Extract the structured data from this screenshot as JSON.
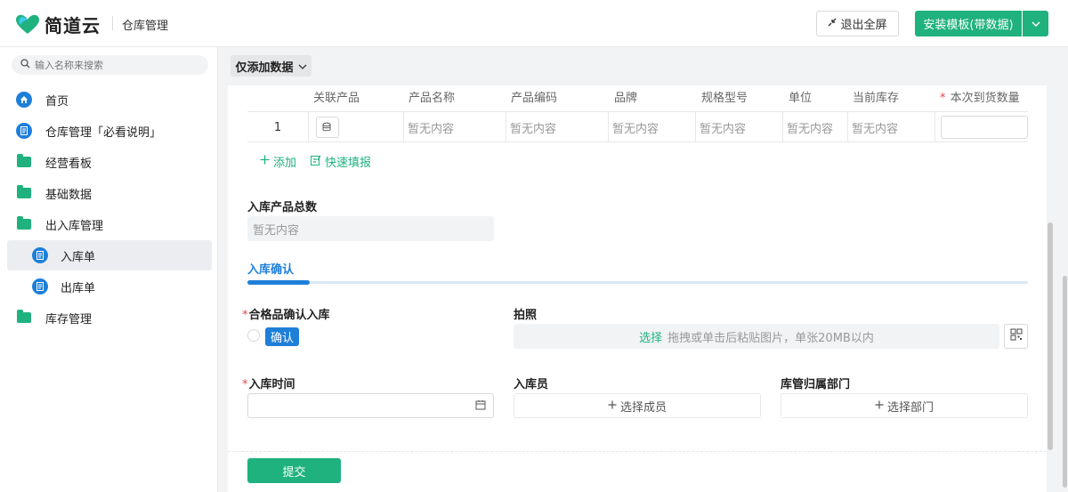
{
  "header": {
    "logo_text": "简道云",
    "app_title": "仓库管理",
    "exit_fullscreen": "退出全屏",
    "install_template": "安装模板(带数据)"
  },
  "sidebar": {
    "search_placeholder": "输入名称来搜索",
    "items": [
      {
        "label": "首页",
        "icon": "home-icon"
      },
      {
        "label": "仓库管理「必看说明」",
        "icon": "document-icon"
      },
      {
        "label": "经营看板",
        "icon": "folder-icon"
      },
      {
        "label": "基础数据",
        "icon": "folder-icon"
      },
      {
        "label": "出入库管理",
        "icon": "folder-open-icon"
      },
      {
        "label": "入库单",
        "icon": "form-icon",
        "active": true
      },
      {
        "label": "出库单",
        "icon": "form-icon"
      },
      {
        "label": "库存管理",
        "icon": "folder-icon"
      }
    ]
  },
  "toolbar": {
    "filter_label": "仅添加数据"
  },
  "table": {
    "headers": [
      "关联产品",
      "产品名称",
      "产品编码",
      "品牌",
      "规格型号",
      "单位",
      "当前库存",
      "本次到货数量"
    ],
    "row": {
      "index": "1",
      "cells": [
        "暂无内容",
        "暂无内容",
        "暂无内容",
        "暂无内容",
        "暂无内容",
        "暂无内容"
      ]
    },
    "add_label": "添加",
    "quick_fill_label": "快速填报"
  },
  "form": {
    "total_label": "入库产品总数",
    "total_value": "暂无内容",
    "section_title": "入库确认",
    "qualified_label": "合格品确认入库",
    "confirm_option": "确认",
    "photo_label": "拍照",
    "upload_select": "选择",
    "upload_hint": "拖拽或单击后粘贴图片，单张20MB以内",
    "time_label": "入库时间",
    "staff_label": "入库员",
    "staff_placeholder": "选择成员",
    "dept_label": "库管归属部门",
    "dept_placeholder": "选择部门",
    "submit_label": "提交"
  },
  "colors": {
    "brand_green": "#1fb27e",
    "accent_blue": "#1e7fd9"
  }
}
